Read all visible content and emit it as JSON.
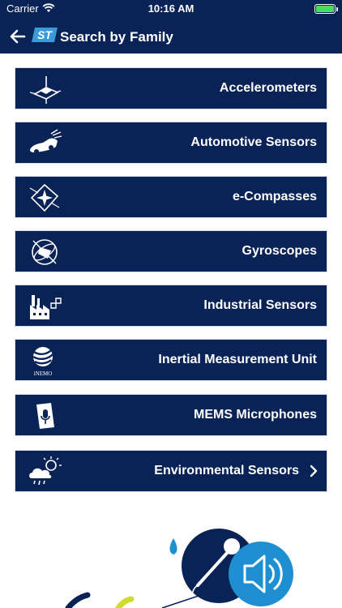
{
  "status_bar": {
    "carrier": "Carrier",
    "time": "10:16 AM",
    "battery_color": "#4cd964"
  },
  "nav": {
    "title": "Search by Family",
    "back_icon": "arrow-left-icon",
    "logo": "st-logo"
  },
  "colors": {
    "header_bg": "#0a2356",
    "row_bg": "#0a2356",
    "row_text": "#ffffff",
    "accent_blue": "#1e8fd0",
    "accent_lime": "#cfdc2b"
  },
  "families": [
    {
      "label": "Accelerometers",
      "icon": "accelerometer-icon"
    },
    {
      "label": "Automotive Sensors",
      "icon": "car-icon"
    },
    {
      "label": "e-Compasses",
      "icon": "compass-icon"
    },
    {
      "label": "Gyroscopes",
      "icon": "gyroscope-icon"
    },
    {
      "label": "Industrial Sensors",
      "icon": "factory-icon"
    },
    {
      "label": "Inertial Measurement Unit",
      "icon": "inemo-icon",
      "icon_caption": "iNEMO"
    },
    {
      "label": "MEMS Microphones",
      "icon": "microphone-icon"
    },
    {
      "label": "Environmental Sensors",
      "icon": "weather-icon"
    }
  ]
}
